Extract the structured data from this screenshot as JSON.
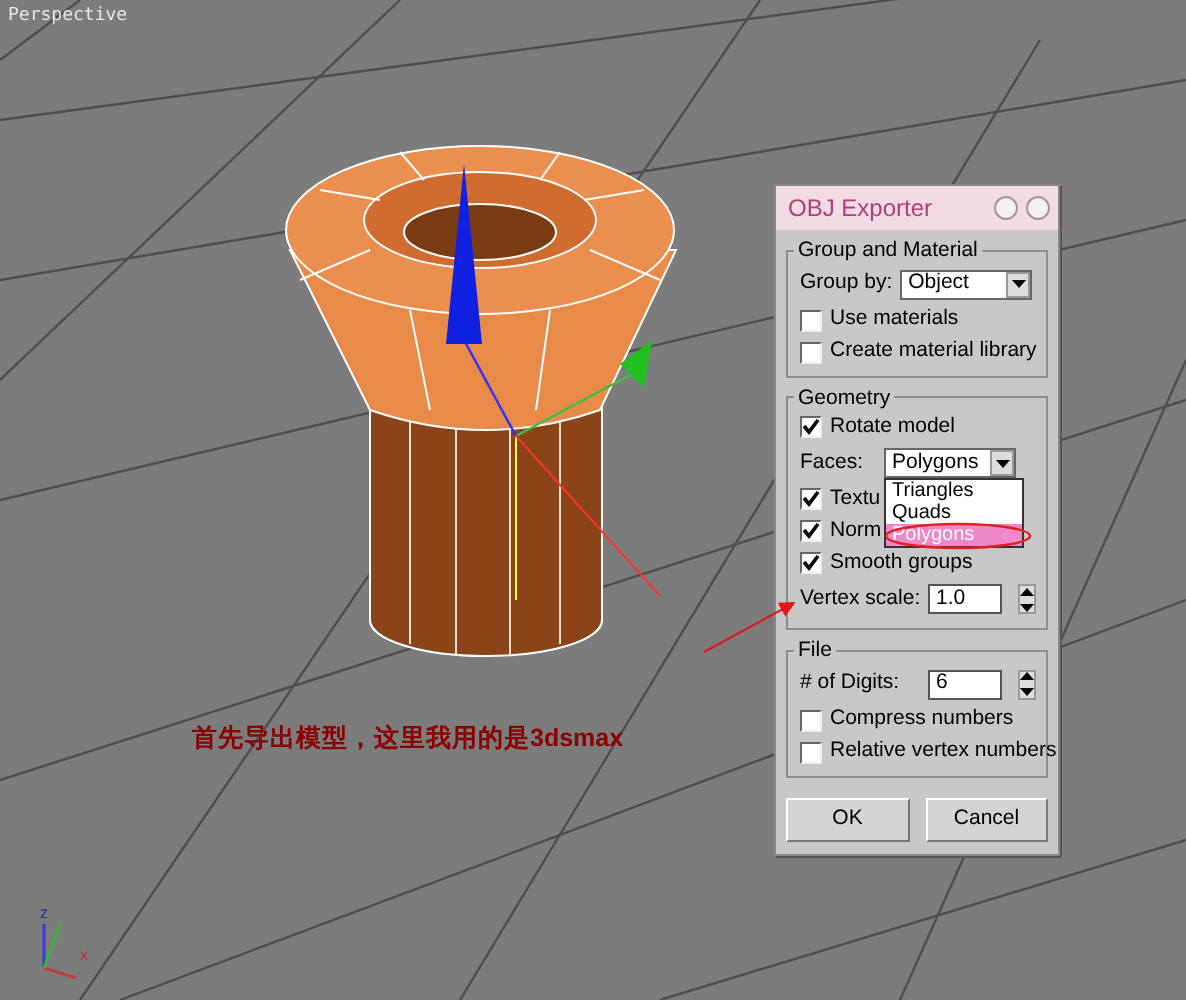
{
  "viewport": {
    "label": "Perspective",
    "axis_labels": [
      "z",
      "x"
    ]
  },
  "annotation": "首先导出模型，这里我用的是3dsmax",
  "dialog": {
    "title": "OBJ Exporter",
    "groups": [
      {
        "title": "Group and Material",
        "rows": [
          {
            "kind": "select",
            "label": "Group by:",
            "value": "Object"
          },
          {
            "kind": "checkbox",
            "label": "Use materials",
            "checked": false
          },
          {
            "kind": "checkbox",
            "label": "Create material library",
            "checked": false
          }
        ]
      },
      {
        "title": "Geometry",
        "rows": [
          {
            "kind": "checkbox",
            "label": "Rotate model",
            "checked": true
          },
          {
            "kind": "select",
            "label": "Faces:",
            "value": "Polygons",
            "expanded": true,
            "options": [
              {
                "label": "Triangles",
                "selected": false
              },
              {
                "label": "Quads",
                "selected": false
              },
              {
                "label": "Polygons",
                "selected": true
              }
            ]
          },
          {
            "kind": "checkbox",
            "label": "Textu",
            "checked": true
          },
          {
            "kind": "checkbox",
            "label": "Norm",
            "checked": true
          },
          {
            "kind": "checkbox",
            "label": "Smooth groups",
            "checked": true
          },
          {
            "kind": "spinner",
            "label": "Vertex scale:",
            "value": "1.0"
          }
        ]
      },
      {
        "title": "File",
        "rows": [
          {
            "kind": "spinner",
            "label": "# of Digits:",
            "value": "6"
          },
          {
            "kind": "checkbox",
            "label": "Compress numbers",
            "checked": false
          },
          {
            "kind": "checkbox",
            "label": "Relative vertex numbers",
            "checked": false
          }
        ]
      }
    ],
    "buttons": [
      "OK",
      "Cancel"
    ]
  }
}
